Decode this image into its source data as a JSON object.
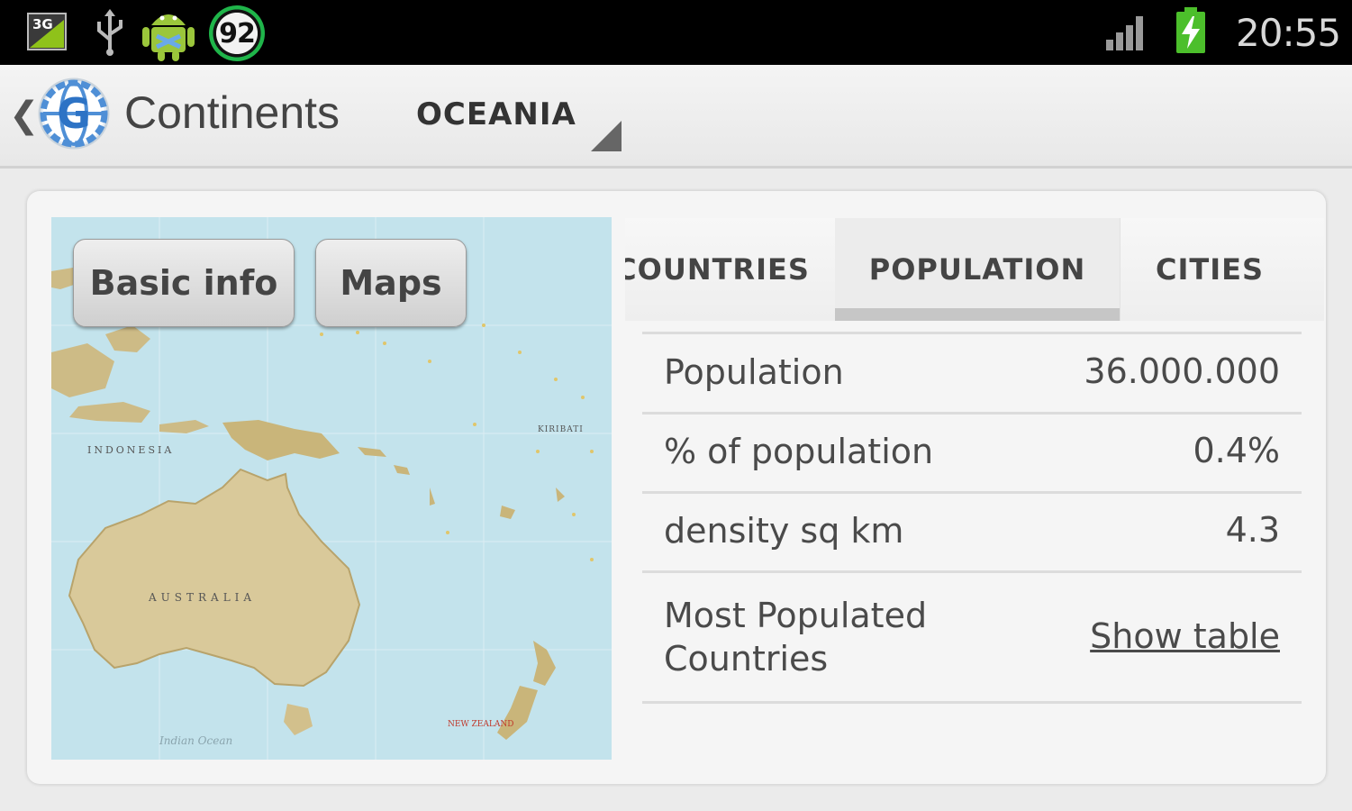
{
  "status_bar": {
    "network_type": "3G",
    "badge_count": "92",
    "time": "20:55"
  },
  "action_bar": {
    "title": "Continents",
    "spinner_value": "OCEANIA"
  },
  "map_buttons": {
    "basic_info": "Basic info",
    "maps": "Maps"
  },
  "tabs": [
    {
      "label": "COUNTRIES"
    },
    {
      "label": "POPULATION",
      "selected": true
    },
    {
      "label": "CITIES"
    }
  ],
  "stats": {
    "rows": [
      {
        "label": "Population",
        "value": "36.000.000"
      },
      {
        "label": "% of population",
        "value": "0.4%"
      },
      {
        "label": "density sq km",
        "value": "4.3"
      },
      {
        "label": "Most Populated Countries",
        "value": "Show table"
      }
    ]
  },
  "map_labels": {
    "indonesia": "INDONESIA",
    "australia": "AUSTRALIA",
    "kiribati": "KIRIBATI",
    "new_zealand": "NEW ZEALAND",
    "indian_ocean": "Indian Ocean"
  },
  "colors": {
    "status_bar_bg": "#000000",
    "battery_green": "#4cbf2b",
    "badge_ring": "#1fb54a",
    "ocean": "#bfe0ea",
    "land": "#d9c99a"
  }
}
